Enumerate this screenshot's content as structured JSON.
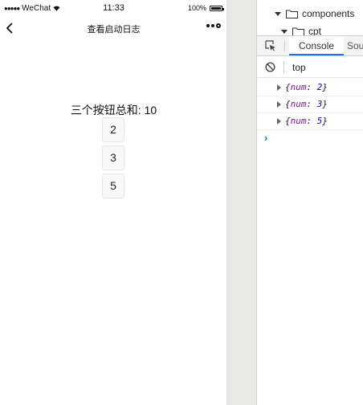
{
  "status_bar": {
    "carrier": "WeChat",
    "time": "11:33",
    "battery": "100%"
  },
  "nav": {
    "title": "查看启动日志"
  },
  "content": {
    "sum_label": "三个按钮总和:",
    "sum_value": "10",
    "buttons": [
      "2",
      "3",
      "5"
    ]
  },
  "devtools": {
    "tree": {
      "row1": "components",
      "row2": "cpt"
    },
    "tabs": {
      "console": "Console",
      "sources": "Sou"
    },
    "context": "top",
    "logs": [
      {
        "key": "num",
        "value": "2"
      },
      {
        "key": "num",
        "value": "3"
      },
      {
        "key": "num",
        "value": "5"
      }
    ],
    "prompt_glyph": "›"
  }
}
